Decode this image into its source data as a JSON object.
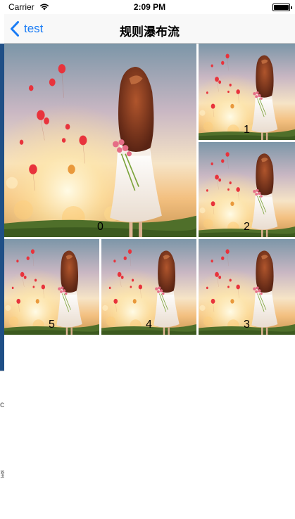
{
  "status_bar": {
    "carrier": "Carrier",
    "time": "2:09 PM",
    "wifi_icon": "wifi-icon",
    "battery_icon": "battery-icon"
  },
  "nav_bar": {
    "back_label": "test",
    "back_icon": "chevron-left-icon",
    "title": "规则瀑布流",
    "tint_color": "#1a7cf5"
  },
  "grid": {
    "items": [
      {
        "label": "0",
        "image": "girl-with-balloons-photo"
      },
      {
        "label": "1",
        "image": "girl-with-balloons-photo"
      },
      {
        "label": "2",
        "image": "girl-with-balloons-photo"
      },
      {
        "label": "3",
        "image": "girl-with-balloons-photo"
      },
      {
        "label": "4",
        "image": "girl-with-balloons-photo"
      },
      {
        "label": "5",
        "image": "girl-with-balloons-photo"
      }
    ]
  },
  "underlying_view": {
    "edge_chars": [
      "c",
      "到"
    ]
  }
}
